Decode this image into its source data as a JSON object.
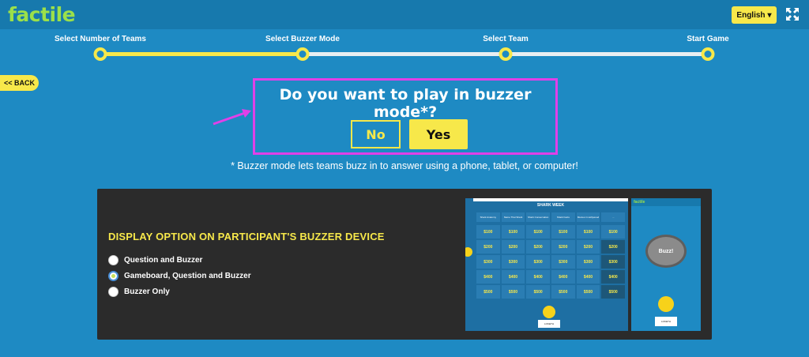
{
  "app": {
    "logo": "factile"
  },
  "header": {
    "language": "English",
    "language_caret": "▾"
  },
  "steps": [
    {
      "label": "Select Number of Teams"
    },
    {
      "label": "Select Buzzer Mode"
    },
    {
      "label": "Select Team"
    },
    {
      "label": "Start Game"
    }
  ],
  "back_label": "<< BACK",
  "prompt": {
    "question": "Do you want to play in buzzer mode*?",
    "no_label": "No",
    "yes_label": "Yes",
    "footnote": "* Buzzer mode lets teams buzz in to answer using a phone, tablet, or computer!"
  },
  "display_options": {
    "heading": "DISPLAY OPTION ON PARTICIPANT'S BUZZER DEVICE",
    "options": [
      {
        "label": "Question and Buzzer",
        "selected": false
      },
      {
        "label": "Gameboard, Question and Buzzer",
        "selected": true
      },
      {
        "label": "Buzzer Only",
        "selected": false
      }
    ]
  },
  "preview": {
    "board_title": "SHARK WEEK",
    "categories": [
      "Shark Anatomy",
      "Name That Shark",
      "Shark Conservation",
      "Shark Facts",
      "Movies in Hollywood",
      "..."
    ],
    "rows": [
      [
        "$100",
        "$100",
        "$100",
        "$100",
        "$100",
        "$100"
      ],
      [
        "$200",
        "$200",
        "$200",
        "$200",
        "$200",
        "$200"
      ],
      [
        "$300",
        "$300",
        "$300",
        "$300",
        "$300",
        "$300"
      ],
      [
        "$400",
        "$400",
        "$400",
        "$400",
        "$400",
        "$400"
      ],
      [
        "$500",
        "$500",
        "$500",
        "$500",
        "$500",
        "$500"
      ]
    ],
    "phone_logo": "factile",
    "buzz_label": "Buzz!",
    "team_label": "LOKETH"
  },
  "colors": {
    "accent_yellow": "#f7e84a",
    "brand_green": "#9be04a",
    "background_blue": "#1e8ac3",
    "highlight_magenta": "#e040e8"
  }
}
